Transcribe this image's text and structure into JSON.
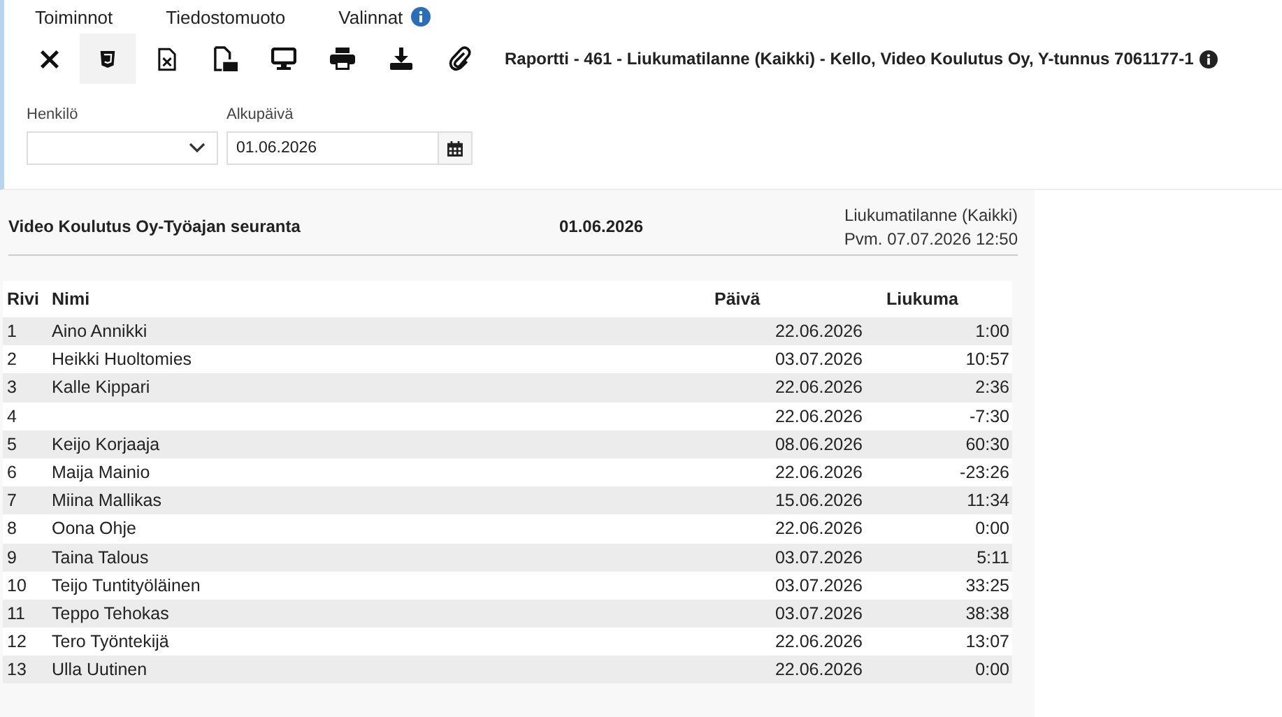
{
  "menu": [
    {
      "label": "Toiminnot"
    },
    {
      "label": "Tiedostomuoto"
    },
    {
      "label": "Valinnat",
      "info": true
    }
  ],
  "toolbar": [
    {
      "kind": "close",
      "selected": false
    },
    {
      "kind": "html",
      "selected": true
    },
    {
      "kind": "excel",
      "selected": false
    },
    {
      "kind": "pdf",
      "selected": false
    },
    {
      "kind": "screen",
      "selected": false
    },
    {
      "kind": "print",
      "selected": false
    },
    {
      "kind": "download",
      "selected": false
    },
    {
      "kind": "attach",
      "selected": false
    }
  ],
  "report_title": "Raportti - 461 - Liukumatilanne (Kaikki) - Kello, Video Koulutus Oy, Y-tunnus 7061177-1",
  "filters": {
    "person": {
      "label": "Henkilö"
    },
    "start_date": {
      "label": "Alkupäivä",
      "value": "01.06.2026"
    }
  },
  "report": {
    "company": "Video Koulutus Oy-Työajan seuranta",
    "date": "01.06.2026",
    "type": "Liukumatilanne (Kaikki)",
    "printed": "Pvm. 07.07.2026 12:50"
  },
  "table": {
    "columns": [
      "Rivi",
      "Nimi",
      "Päivä",
      "Liukuma"
    ],
    "rows": [
      [
        "1",
        "Aino Annikki",
        "22.06.2026",
        "1:00"
      ],
      [
        "2",
        "Heikki Huoltomies",
        "03.07.2026",
        "10:57"
      ],
      [
        "3",
        "Kalle Kippari",
        "22.06.2026",
        "2:36"
      ],
      [
        "4",
        "",
        "22.06.2026",
        "-7:30"
      ],
      [
        "5",
        "Keijo Korjaaja",
        "08.06.2026",
        "60:30"
      ],
      [
        "6",
        "Maija Mainio",
        "22.06.2026",
        "-23:26"
      ],
      [
        "7",
        "Miina Mallikas",
        "15.06.2026",
        "11:34"
      ],
      [
        "8",
        "Oona Ohje",
        "22.06.2026",
        "0:00"
      ],
      [
        "9",
        "Taina Talous",
        "03.07.2026",
        "5:11"
      ],
      [
        "10",
        "Teijo Tuntityöläinen",
        "03.07.2026",
        "33:25"
      ],
      [
        "11",
        "Teppo Tehokas",
        "03.07.2026",
        "38:38"
      ],
      [
        "12",
        "Tero Työntekijä",
        "22.06.2026",
        "13:07"
      ],
      [
        "13",
        "Ulla Uutinen",
        "22.06.2026",
        "0:00"
      ]
    ]
  }
}
